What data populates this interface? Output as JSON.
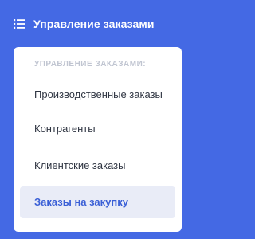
{
  "header": {
    "icon": "list-icon",
    "title": "Управление заказами"
  },
  "menu": {
    "section_label": "УПРАВЛЕНИЕ ЗАКАЗАМИ:",
    "items": [
      {
        "label": "Производственные заказы",
        "active": false
      },
      {
        "label": "Контрагенты",
        "active": false
      },
      {
        "label": "Клиентские заказы",
        "active": false
      },
      {
        "label": "Заказы на закупку",
        "active": true
      }
    ]
  },
  "colors": {
    "background": "#4469e4",
    "card": "#ffffff",
    "active_bg": "#e9ecf7",
    "active_text": "#3a5fd6",
    "section_label": "#c0c5d1",
    "item_text": "#2f3542"
  }
}
